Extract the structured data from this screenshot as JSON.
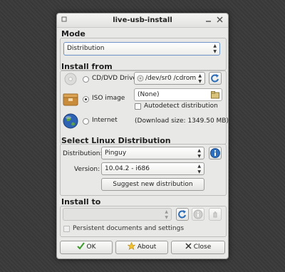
{
  "window": {
    "title": "live-usb-install"
  },
  "mode": {
    "title": "Mode",
    "selected": "Distribution"
  },
  "install_from": {
    "title": "Install from",
    "cd_label": "CD/DVD Drive",
    "cd_device": "/dev/sr0 /cdrom",
    "iso_label": "ISO image",
    "iso_value": "(None)",
    "autodetect_label": "Autodetect distribution",
    "internet_label": "Internet",
    "download_size": "(Download size: 1349.50 MB)"
  },
  "distribution": {
    "title": "Select Linux Distribution",
    "dist_label": "Distribution:",
    "dist_value": "Pinguy",
    "version_label": "Version:",
    "version_value": "10.04.2 - i686",
    "suggest_label": "Suggest new distribution"
  },
  "install_to": {
    "title": "Install to",
    "persistent_label": "Persistent documents and settings"
  },
  "buttons": {
    "ok": "OK",
    "about": "About",
    "close": "Close"
  },
  "colors": {
    "info_blue": "#2f6fbf",
    "ok_green": "#3a9a2a",
    "refresh_blue": "#2a6cb8"
  }
}
